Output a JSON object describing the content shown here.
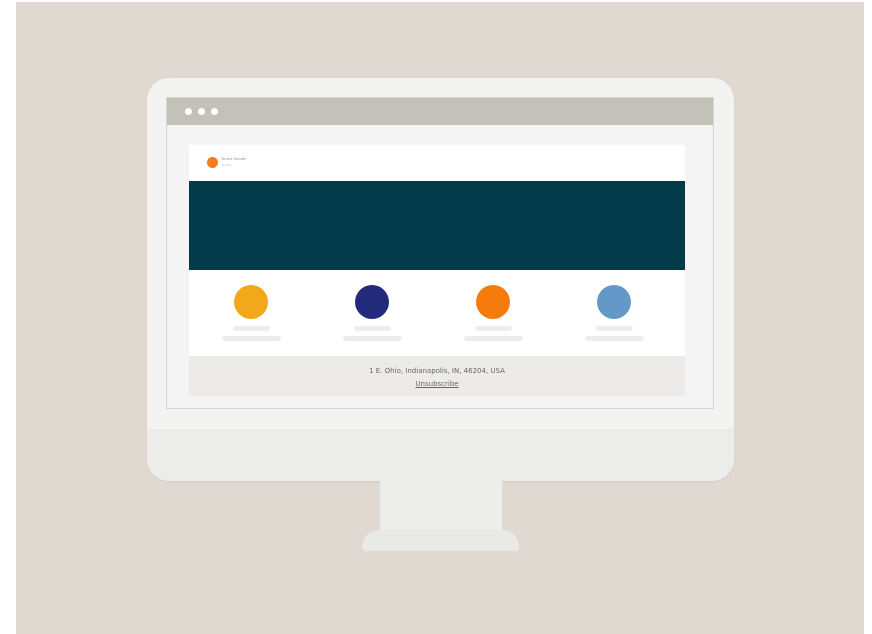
{
  "colors": {
    "background": "#e0d9d2",
    "monitor": "#f3f3f2",
    "titlebar": "#c4c1b8",
    "hero": "#023a4a",
    "footer": "#ecebe9"
  },
  "browser": {
    "window_controls": [
      "dot",
      "dot",
      "dot"
    ]
  },
  "email": {
    "sender": {
      "avatar_color": "#f47b20",
      "name": "Knack Sender",
      "meta": "to me"
    },
    "hero_color": "#023a4a",
    "features": [
      {
        "color": "#f2a818",
        "icon": "yellow-circle"
      },
      {
        "color": "#232a7b",
        "icon": "navy-circle"
      },
      {
        "color": "#f47b0c",
        "icon": "orange-circle"
      },
      {
        "color": "#6498c8",
        "icon": "blue-circle"
      }
    ],
    "footer": {
      "address": "1 E. Ohio, Indianapolis, IN, 46204, USA",
      "unsubscribe": "Unsubscribe"
    }
  }
}
